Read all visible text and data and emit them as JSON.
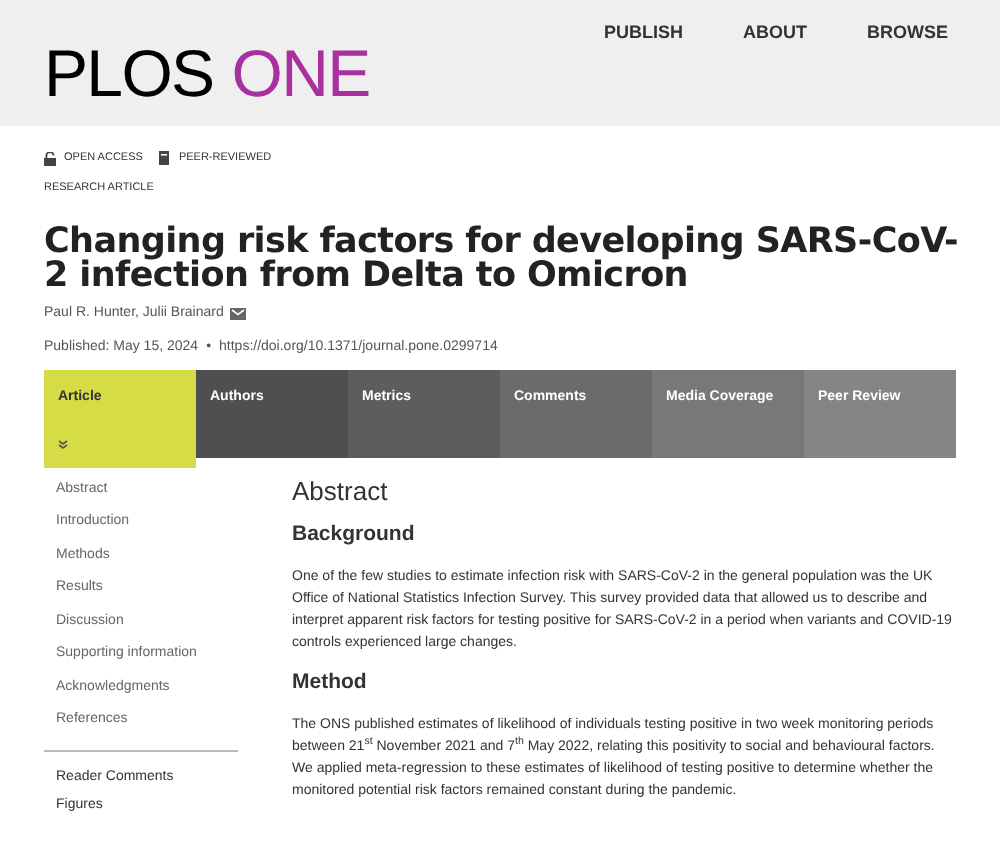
{
  "header": {
    "logo": {
      "primary": "PLOS",
      "accent": "ONE"
    },
    "nav": [
      "PUBLISH",
      "ABOUT",
      "BROWSE"
    ]
  },
  "badges": [
    "OPEN ACCESS",
    "PEER-REVIEWED"
  ],
  "article_type": "RESEARCH ARTICLE",
  "title": "Changing risk factors for developing SARS-CoV-2 infection from Delta to Omicron",
  "authors": "Paul R. Hunter, Julii Brainard",
  "published": "Published: May 15, 2024",
  "separator": "•",
  "doi": "https://doi.org/10.1371/journal.pone.0299714",
  "tabs": [
    {
      "label": "Article",
      "selected": true
    },
    {
      "label": "Authors",
      "selected": false
    },
    {
      "label": "Metrics",
      "selected": false
    },
    {
      "label": "Comments",
      "selected": false
    },
    {
      "label": "Media Coverage",
      "selected": false
    },
    {
      "label": "Peer Review",
      "selected": false
    }
  ],
  "sidebar": {
    "sections": [
      "Abstract",
      "Introduction",
      "Methods",
      "Results",
      "Discussion",
      "Supporting information",
      "Acknowledgments",
      "References"
    ],
    "links": [
      "Reader Comments",
      "Figures"
    ]
  },
  "main": {
    "heading": "Abstract",
    "sections": [
      {
        "heading": "Background",
        "text": "One of the few studies to estimate infection risk with SARS-CoV-2 in the general population was the UK Office of National Statistics Infection Survey. This survey provided data that allowed us to describe and interpret apparent risk factors for testing positive for SARS-CoV-2 in a period when variants and COVID-19 controls experienced large changes."
      },
      {
        "heading": "Method",
        "text": "The ONS published estimates of likelihood of individuals testing positive in two week monitoring periods between 21$^{st}$ November 2021 and 7$^{th}$ May 2022, relating this positivity to social and behavioural factors. We applied meta-regression to these estimates of likelihood of testing positive to determine whether the monitored potential risk factors remained constant during the pandemic."
      }
    ]
  }
}
